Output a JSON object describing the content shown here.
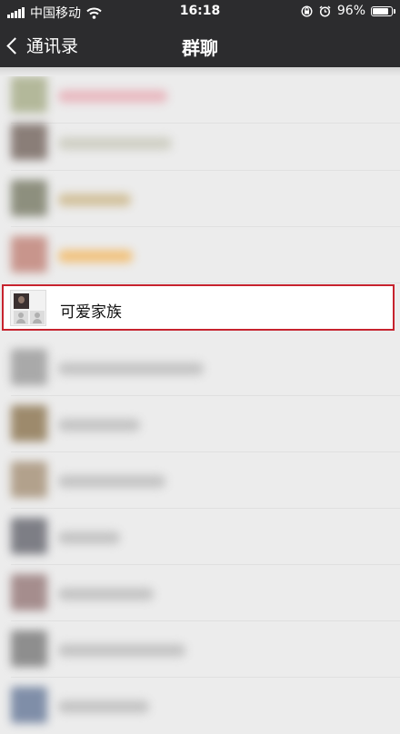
{
  "status_bar": {
    "carrier": "中国移动",
    "time": "16:18",
    "battery": "96%",
    "battery_level": 0.96,
    "icons": [
      "signal-icon",
      "wifi-icon",
      "lock-rotation-icon",
      "alarm-icon",
      "battery-icon"
    ]
  },
  "nav": {
    "back_label": "通讯录",
    "title": "群聊"
  },
  "highlighted_group": {
    "name": "可爱家族"
  },
  "colors": {
    "bar_background": "#2c2c2e",
    "list_background": "#ececec",
    "highlight_border": "#c7232e"
  }
}
